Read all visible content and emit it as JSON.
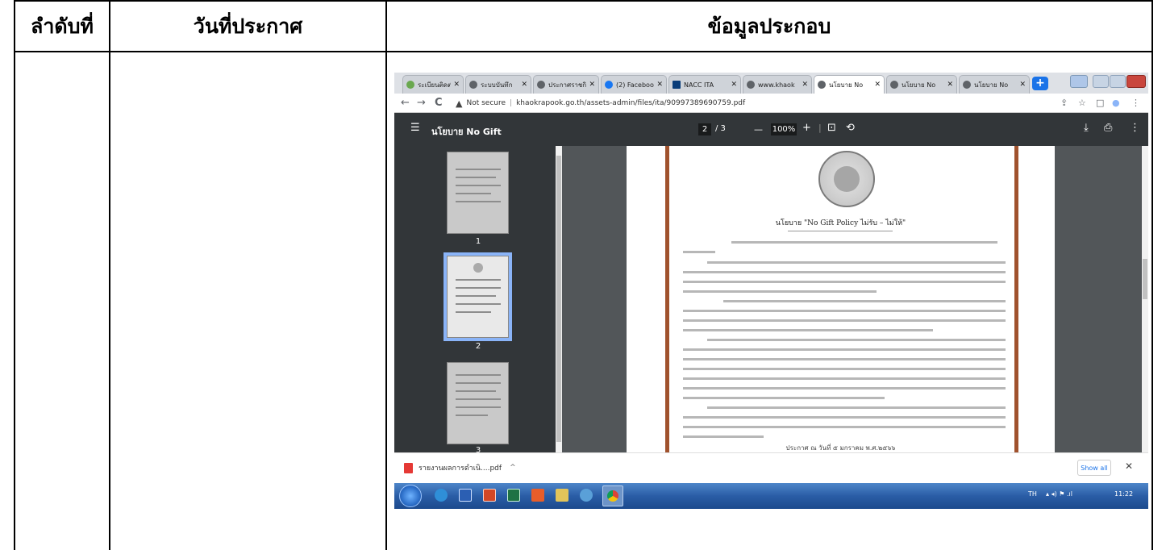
{
  "table": {
    "headers": {
      "col1": "ลำดับที่",
      "col2": "วันที่ประกาศ",
      "col3": "ข้อมูลประกอบ"
    }
  },
  "browser": {
    "tabs": [
      {
        "label": "ระเบียนติดต่อนำ"
      },
      {
        "label": "ระบบบันทึก"
      },
      {
        "label": "ประกาศราชกิ"
      },
      {
        "label": "(2) Facebook"
      },
      {
        "label": "NACC ITA"
      },
      {
        "label": "www.khaok"
      },
      {
        "label": "นโยบาย No"
      },
      {
        "label": "นโยบาย No"
      },
      {
        "label": "นโยบาย No"
      }
    ],
    "tab_close": "✕",
    "new_tab": "+",
    "nav": {
      "back": "←",
      "forward": "→",
      "reload": "C"
    },
    "security_label": "Not secure",
    "url": "khaokrapook.go.th/assets-admin/files/ita/90997389690759.pdf",
    "right_icons": {
      "share": "⇪",
      "star": "☆",
      "sidebar": "□",
      "profile": "●",
      "menu": "⋮"
    }
  },
  "pdf": {
    "menu_icon": "☰",
    "title": "นโยบาย No Gift",
    "page_current": "2",
    "page_total": "/ 3",
    "zoom_minus": "—",
    "zoom": "100%",
    "zoom_plus": "+",
    "fit_icon": "⊡",
    "rotate_icon": "⟲",
    "download_icon": "⤓",
    "print_icon": "⎙",
    "more_icon": "⋮",
    "thumbs": [
      {
        "num": "1"
      },
      {
        "num": "2"
      },
      {
        "num": "3"
      }
    ],
    "doc_title": "นโยบาย \"No Gift Policy ไม่รับ – ไม่ให้\"",
    "doc_footer": "ประกาศ ณ วันที่  ๕  มกราคม พ.ศ.๒๕๖๖"
  },
  "download": {
    "file": "รายงานผลการดำเนิ....pdf",
    "chevron": "^",
    "show_all": "Show all",
    "close": "✕"
  },
  "taskbar": {
    "lang": "TH",
    "tray_icons": "▴ ◂) ⚑ .ıl",
    "time": "11:22"
  },
  "colors": {
    "accent": "#1a73e8",
    "pdf_toolbar": "#323639",
    "viewer_bg": "#525659",
    "taskbar": "#2a5da6",
    "page_stripe": "#a0522d"
  }
}
